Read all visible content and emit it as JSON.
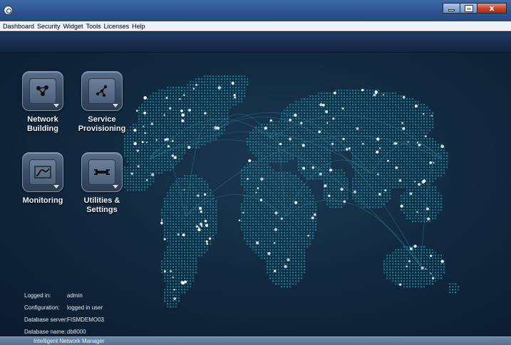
{
  "window": {
    "close_glyph": "x"
  },
  "menu": [
    {
      "label": "Dashboard"
    },
    {
      "label": "Security"
    },
    {
      "label": "Widget"
    },
    {
      "label": "Tools"
    },
    {
      "label": "Licenses"
    },
    {
      "label": "Help"
    }
  ],
  "launchers": [
    {
      "line1": "Network",
      "line2": "Building",
      "icon": "network-diagram-icon"
    },
    {
      "line1": "Service",
      "line2": "Provisioning",
      "icon": "service-diagram-icon"
    },
    {
      "line1": "Monitoring",
      "line2": "",
      "icon": "waveform-icon"
    },
    {
      "line1": "Utilities &",
      "line2": "Settings",
      "icon": "wrench-icon"
    }
  ],
  "info": {
    "logged_in": {
      "label": "Logged in:",
      "value": "admin"
    },
    "configuration": {
      "label": "Configuration:",
      "value": "logged in user"
    },
    "database_server": {
      "label": "Database server:",
      "value": "FISMDEMO03"
    },
    "database_name": {
      "label": "Database name:",
      "value": "db8000"
    }
  },
  "statusbar": {
    "text": "Intelligent Network Manager"
  },
  "colors": {
    "title_bar": "#2d5490",
    "menu_bar": "#eef0f3",
    "map_background": "#122a40",
    "map_dots": "#2a8fa3",
    "city_lights": "#ffffff",
    "status_bar": "#56708f"
  }
}
